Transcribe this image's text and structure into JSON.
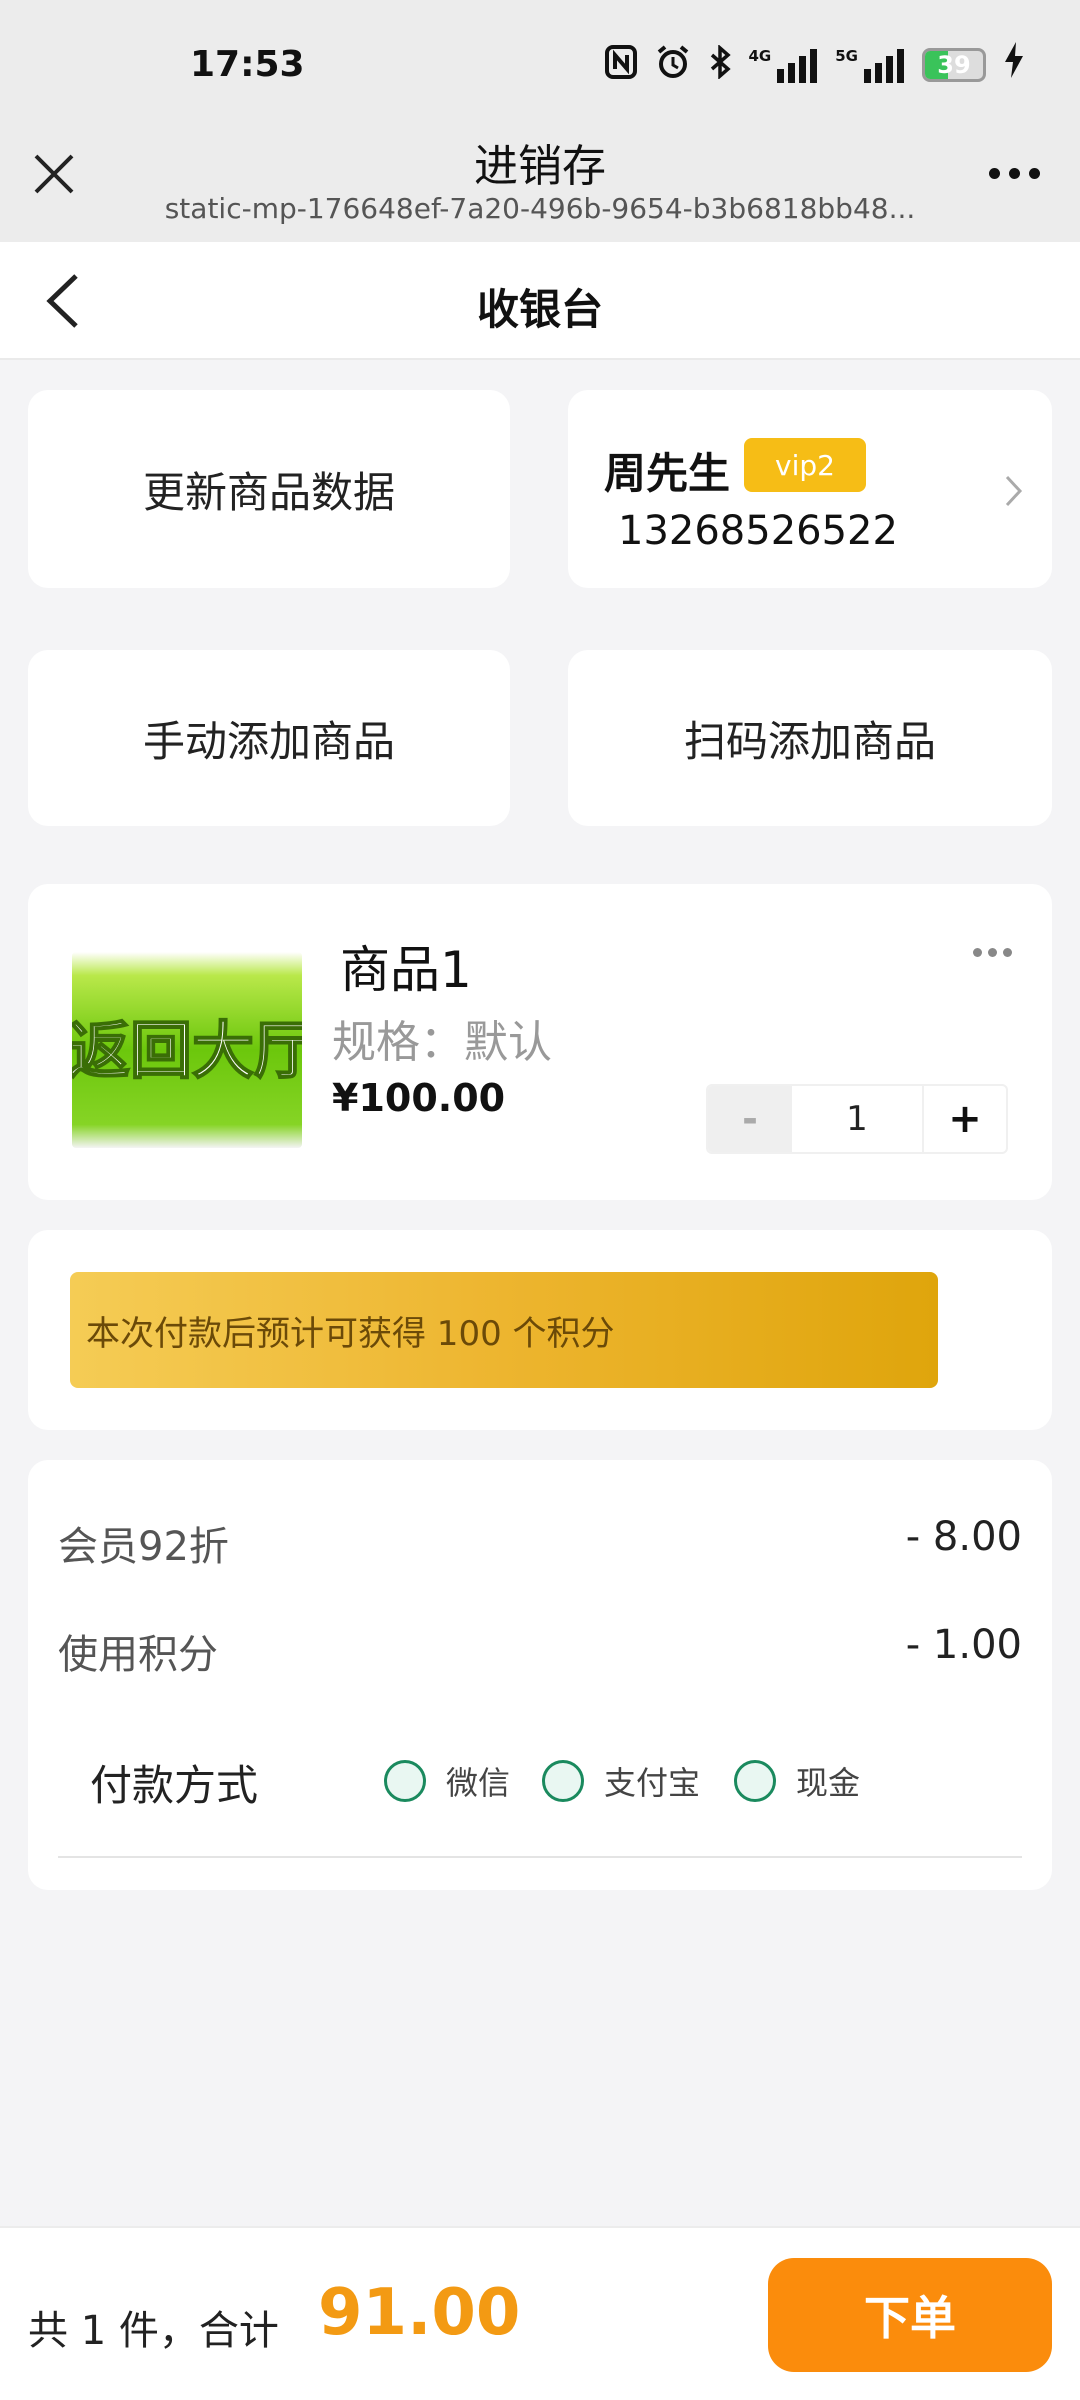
{
  "status_bar": {
    "time": "17:53",
    "icons": [
      "nfc-icon",
      "alarm-icon",
      "bluetooth-icon",
      "signal-4g-icon",
      "signal-5g-icon",
      "battery-icon",
      "charging-icon"
    ],
    "net1": "4G",
    "net2": "5G",
    "battery_level": "39"
  },
  "mini_program_header": {
    "title": "进销存",
    "url": "static-mp-176648ef-7a20-496b-9654-b3b6818bb48..."
  },
  "nav": {
    "title": "收银台"
  },
  "actions": {
    "update_products": "更新商品数据",
    "manual_add": "手动添加商品",
    "scan_add": "扫码添加商品"
  },
  "member": {
    "name": "周先生",
    "level": "vip2",
    "phone": "13268526522"
  },
  "cart": {
    "items": [
      {
        "name": "商品1",
        "spec": "规格：默认",
        "price": "¥100.00",
        "quantity": "1",
        "image_text": "返回大厅"
      }
    ],
    "minus": "-",
    "plus": "+"
  },
  "points_notice": "本次付款后预计可获得 100 个积分",
  "summary": {
    "discount_label": "会员92折",
    "discount_value": "- 8.00",
    "points_label": "使用积分",
    "points_value": "- 1.00",
    "payment_label": "付款方式",
    "payment_options": [
      "微信",
      "支付宝",
      "现金"
    ]
  },
  "footer": {
    "total_prefix": "共 1 件，合计",
    "total_amount": "91.00",
    "order_button": "下单"
  },
  "colors": {
    "accent_orange": "#fb8c0c",
    "total_orange": "#f39a13",
    "vip_yellow": "#f6bd16",
    "radio_green": "#1a8a5e"
  }
}
